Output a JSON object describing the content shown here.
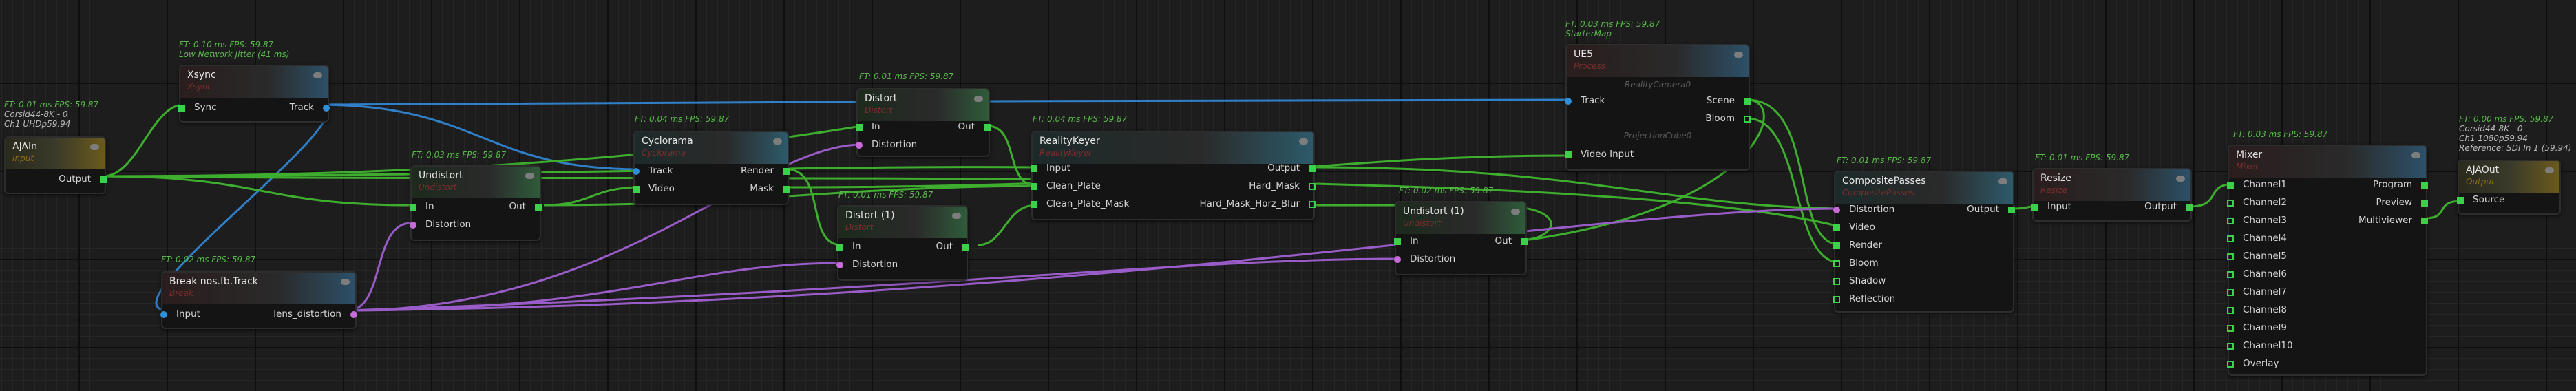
{
  "nodes": {
    "ajain": {
      "title": "AJAIn",
      "type": "Input",
      "stats": [
        "FT: 0.01 ms FPS: 59.87",
        "Corsid44-8K - 0",
        "Ch1 UHDp59.94"
      ],
      "outputs": [
        "Output"
      ]
    },
    "xsync": {
      "title": "Xsync",
      "type": "Xsync",
      "stats": [
        "FT: 0.10 ms FPS: 59.87",
        "Low Network Jitter (41 ms)"
      ],
      "inputs": [
        "Sync"
      ],
      "outputs": [
        "Track"
      ]
    },
    "break": {
      "title": "Break nos.fb.Track",
      "type": "Break",
      "stats": [
        "FT: 0.02 ms FPS: 59.87"
      ],
      "inputs": [
        "Input"
      ],
      "outputs": [
        "lens_distortion"
      ]
    },
    "undistort": {
      "title": "Undistort",
      "type": "Undistort",
      "stats": [
        "FT: 0.03 ms FPS: 59.87"
      ],
      "inputs": [
        "In",
        "Distortion"
      ],
      "outputs": [
        "Out"
      ]
    },
    "cyclorama": {
      "title": "Cyclorama",
      "type": "Cyclorama",
      "stats": [
        "FT: 0.04 ms FPS: 59.87"
      ],
      "inputs": [
        "Track",
        "Video"
      ],
      "outputs": [
        "Render",
        "Mask"
      ]
    },
    "distort": {
      "title": "Distort",
      "type": "Distort",
      "stats": [
        "FT: 0.01 ms FPS: 59.87"
      ],
      "inputs": [
        "In",
        "Distortion"
      ],
      "outputs": [
        "Out"
      ]
    },
    "distort1": {
      "title": "Distort (1)",
      "type": "Distort",
      "stats": [
        "FT: 0.01 ms FPS: 59.87"
      ],
      "inputs": [
        "In",
        "Distortion"
      ],
      "outputs": [
        "Out"
      ]
    },
    "realitykeyer": {
      "title": "RealityKeyer",
      "type": "RealityKeyer",
      "stats": [
        "FT: 0.04 ms FPS: 59.87"
      ],
      "inputs": [
        "Input",
        "Clean_Plate",
        "Clean_Plate_Mask"
      ],
      "outputs": [
        "Output",
        "Hard_Mask",
        "Hard_Mask_Horz_Blur"
      ]
    },
    "ue5": {
      "title": "UE5",
      "type": "Process",
      "stats": [
        "FT: 0.03 ms FPS: 59.87",
        "StarterMap"
      ],
      "sep1": "RealityCamera0",
      "sep2": "ProjectionCube0",
      "inputs": [
        "Track",
        "Video Input"
      ],
      "outputs": [
        "Scene",
        "Bloom"
      ]
    },
    "undistort1": {
      "title": "Undistort (1)",
      "type": "Undistort",
      "stats": [
        "FT: 0.02 ms FPS: 59.87"
      ],
      "inputs": [
        "In",
        "Distortion"
      ],
      "outputs": [
        "Out"
      ]
    },
    "composite": {
      "title": "CompositePasses",
      "type": "CompositePasses",
      "stats": [
        "FT: 0.01 ms FPS: 59.87"
      ],
      "inputs": [
        "Distortion",
        "Video",
        "Render",
        "Bloom",
        "Shadow",
        "Reflection"
      ],
      "outputs": [
        "Output"
      ]
    },
    "resize": {
      "title": "Resize",
      "type": "Resize",
      "stats": [
        "FT: 0.01 ms FPS: 59.87"
      ],
      "inputs": [
        "Input"
      ],
      "outputs": [
        "Output"
      ]
    },
    "mixer": {
      "title": "Mixer",
      "type": "Mixer",
      "stats": [
        "FT: 0.03 ms FPS: 59.87"
      ],
      "inputs": [
        "Channel1",
        "Channel2",
        "Channel3",
        "Channel4",
        "Channel5",
        "Channel6",
        "Channel7",
        "Channel8",
        "Channel9",
        "Channel10",
        "Overlay"
      ],
      "outputs": [
        "Program",
        "Preview",
        "Multiviewer"
      ]
    },
    "ajaout": {
      "title": "AJAOut",
      "type": "Output",
      "stats": [
        "FT: 0.00 ms FPS: 59.87",
        "Corsid44-8K - 0",
        "Ch1 1080p59.94",
        "Reference: SDI In 1 (59.94)"
      ],
      "inputs": [
        "Source"
      ]
    }
  },
  "colors": {
    "track_wire": "#2f80c8",
    "video_wire": "#3eae2e",
    "distortion_wire": "#9a5cc8",
    "pin_green": "#3bd14a",
    "pin_blue": "#2f8fd8",
    "pin_pink": "#c86ad8",
    "grid_bg": "#1d1d1d"
  }
}
